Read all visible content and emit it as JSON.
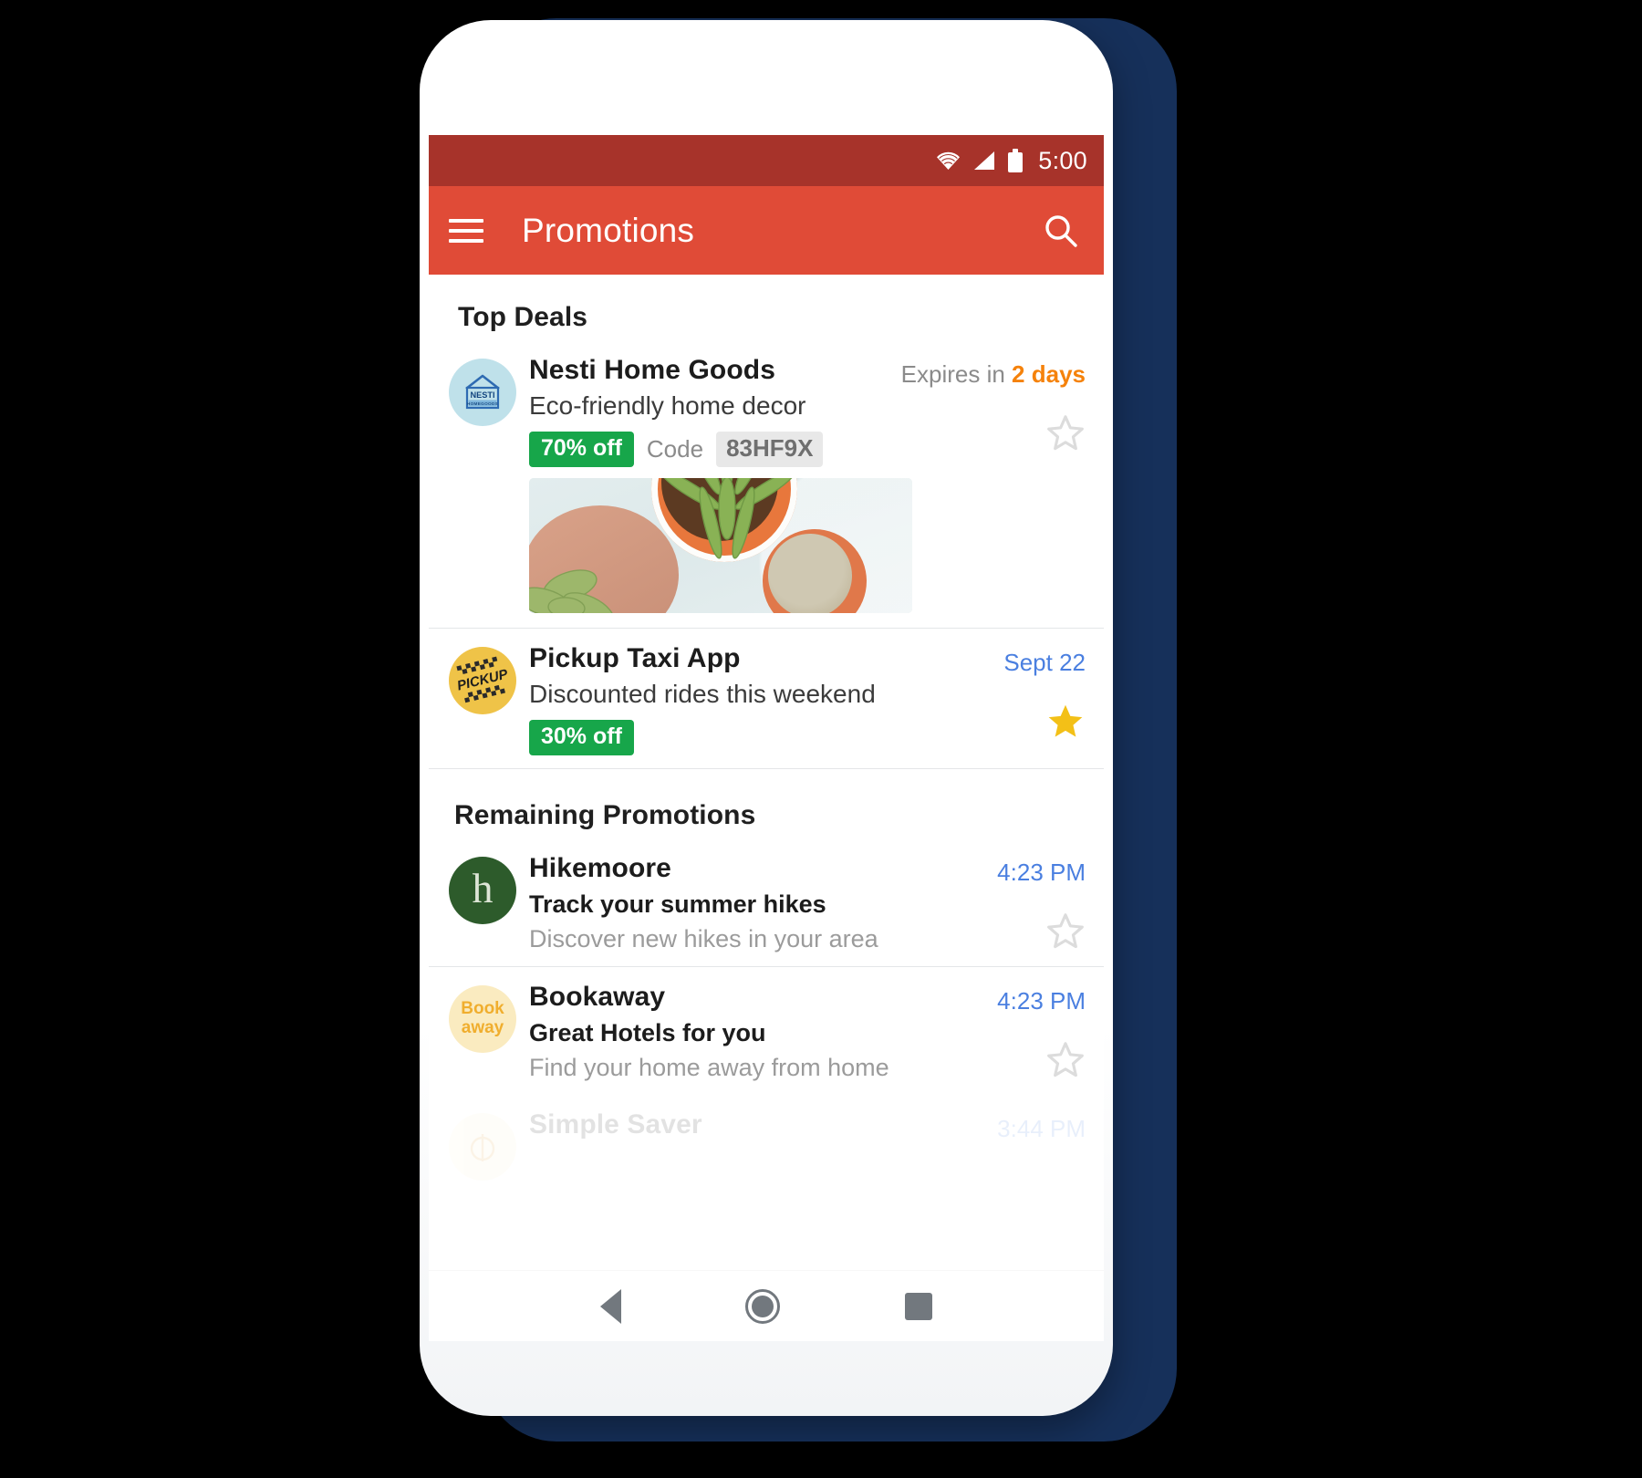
{
  "status_bar": {
    "time": "5:00",
    "icons": [
      "wifi-icon",
      "signal-icon",
      "battery-icon"
    ]
  },
  "app_bar": {
    "menu_icon": "hamburger-menu-icon",
    "title": "Promotions",
    "search_icon": "search-icon"
  },
  "sections": [
    {
      "id": "top-deals",
      "title": "Top Deals"
    },
    {
      "id": "remaining",
      "title": "Remaining Promotions"
    }
  ],
  "top_deals": [
    {
      "sender": "Nesti Home Goods",
      "subject": "Eco-friendly home decor",
      "discount": "70% off",
      "code_label": "Code",
      "code_value": "83HF9X",
      "meta_prefix": "Expires in ",
      "meta_highlight": "2 days",
      "starred": false,
      "avatar": {
        "type": "nesti-logo",
        "bg": "#BFE1EA",
        "brand": "NESTI",
        "sub": "HOMEGOODS"
      },
      "image": "succulent-plants-photo"
    },
    {
      "sender": "Pickup Taxi App",
      "subject": "Discounted rides this weekend",
      "discount": "30% off",
      "date": "Sept 22",
      "starred": true,
      "avatar": {
        "type": "pickup-logo",
        "bg": "#EFC348",
        "brand": "PICKUP"
      }
    }
  ],
  "remaining_promotions": [
    {
      "sender": "Hikemoore",
      "subject": "Track your summer hikes",
      "snippet": "Discover new hikes in your area",
      "time": "4:23 PM",
      "starred": false,
      "avatar": {
        "type": "letter",
        "bg": "#2D5B2B",
        "letter": "h"
      }
    },
    {
      "sender": "Bookaway",
      "subject": "Great Hotels for you",
      "snippet": "Find your home away from home",
      "time": "4:23 PM",
      "starred": false,
      "avatar": {
        "type": "wordmark",
        "bg": "#FAEBC0",
        "line1": "Book",
        "line2": "away"
      }
    },
    {
      "sender": "Simple Saver",
      "time": "3:44 PM",
      "starred": false,
      "avatar": {
        "type": "icon",
        "bg": "#FDF3D2"
      }
    }
  ],
  "nav_bar": {
    "back": "back-nav-icon",
    "home": "home-nav-icon",
    "recents": "recents-nav-icon"
  },
  "colors": {
    "status_bar": "#A7332A",
    "app_bar": "#E04B37",
    "discount_badge": "#17A64A",
    "date_blue": "#4A7FE0",
    "expiry_orange": "#F5820B",
    "star_filled": "#F3C017",
    "star_outline": "#DCDCDC",
    "backdrop_navy": "#16305a"
  }
}
